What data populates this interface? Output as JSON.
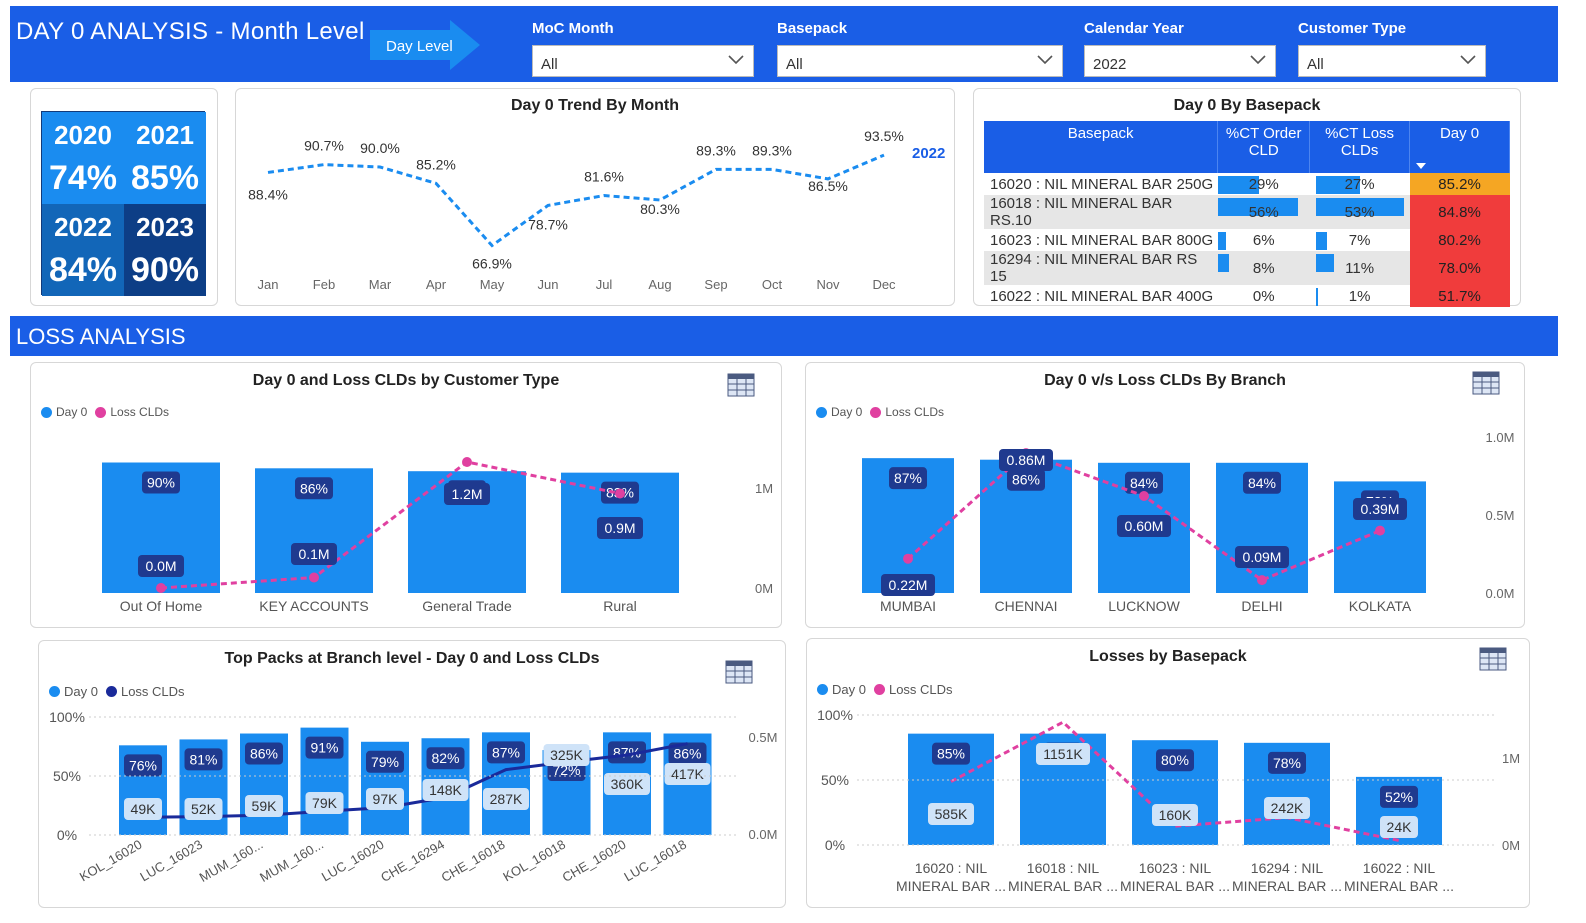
{
  "header": {
    "title": "DAY 0 ANALYSIS - Month Level",
    "day_level_button": "Day Level",
    "filters": [
      {
        "label": "MoC Month",
        "value": "All"
      },
      {
        "label": "Basepack",
        "value": "All"
      },
      {
        "label": "Calendar Year",
        "value": "2022"
      },
      {
        "label": "Customer Type",
        "value": "All"
      }
    ]
  },
  "year_cards": [
    {
      "year": "2020",
      "pct": "74%",
      "color": "#1a8cf0"
    },
    {
      "year": "2021",
      "pct": "85%",
      "color": "#1a8cf0"
    },
    {
      "year": "2022",
      "pct": "84%",
      "color": "#1266b8"
    },
    {
      "year": "2023",
      "pct": "90%",
      "color": "#0d3e86"
    }
  ],
  "trend": {
    "title": "Day 0 Trend By Month",
    "series_label": "2022",
    "chart_data": {
      "type": "line",
      "categories": [
        "Jan",
        "Feb",
        "Mar",
        "Apr",
        "May",
        "Jun",
        "Jul",
        "Aug",
        "Sep",
        "Oct",
        "Nov",
        "Dec"
      ],
      "values": [
        88.4,
        90.7,
        90.0,
        85.2,
        66.9,
        78.7,
        81.6,
        80.3,
        89.3,
        89.3,
        86.5,
        93.5
      ],
      "labels": [
        "88.4%",
        "90.7%",
        "90.0%",
        "85.2%",
        "66.9%",
        "78.7%",
        "81.6%",
        "80.3%",
        "89.3%",
        "89.3%",
        "86.5%",
        "93.5%"
      ],
      "color": "#1a8cf0"
    }
  },
  "basepack_table": {
    "title": "Day 0 By Basepack",
    "columns": [
      "Basepack",
      "%CT Order CLD",
      "%CT Loss CLDs",
      "Day 0"
    ],
    "rows": [
      {
        "name": "16020 : NIL MINERAL BAR 250G",
        "order": "29%",
        "order_v": 29,
        "loss": "27%",
        "loss_v": 27,
        "day0": "85.2%",
        "color": "#f5a623"
      },
      {
        "name": "16018 : NIL MINERAL BAR RS.10",
        "order": "56%",
        "order_v": 56,
        "loss": "53%",
        "loss_v": 53,
        "day0": "84.8%",
        "color": "#f03c3c"
      },
      {
        "name": "16023 : NIL MINERAL BAR 800G",
        "order": "6%",
        "order_v": 6,
        "loss": "7%",
        "loss_v": 7,
        "day0": "80.2%",
        "color": "#f03c3c"
      },
      {
        "name": "16294 : NIL MINERAL BAR RS 15",
        "order": "8%",
        "order_v": 8,
        "loss": "11%",
        "loss_v": 11,
        "day0": "78.0%",
        "color": "#f03c3c"
      },
      {
        "name": "16022 : NIL MINERAL BAR 400G",
        "order": "0%",
        "order_v": 0,
        "loss": "1%",
        "loss_v": 1,
        "day0": "51.7%",
        "color": "#f03c3c"
      }
    ]
  },
  "loss_section": {
    "title": "LOSS ANALYSIS"
  },
  "legend": {
    "day0": "Day 0",
    "loss": "Loss CLDs"
  },
  "colors": {
    "blue": "#1a8cf0",
    "pink": "#e040a0",
    "navy": "#1a2a9a",
    "label_bg": "#1f3a8f"
  },
  "customer_chart": {
    "title": "Day 0 and Loss CLDs by Customer Type",
    "chart_data": {
      "type": "bar",
      "categories": [
        "Out Of Home",
        "KEY ACCOUNTS",
        "General Trade",
        "Rural"
      ],
      "day0_pct": [
        90,
        86,
        84,
        83
      ],
      "day0_labels": [
        "90%",
        "86%",
        "84%",
        "83%"
      ],
      "loss_values": [
        0.0,
        0.1,
        1.2,
        0.9
      ],
      "loss_labels": [
        "0.0M",
        "0.1M",
        "1.2M",
        "0.9M"
      ],
      "right_axis_ticks": [
        "1M",
        "0M"
      ]
    }
  },
  "branch_chart": {
    "title": "Day 0 v/s Loss CLDs By Branch",
    "chart_data": {
      "type": "bar",
      "categories": [
        "MUMBAI",
        "CHENNAI",
        "LUCKNOW",
        "DELHI",
        "KOLKATA"
      ],
      "day0_pct": [
        87,
        86,
        84,
        84,
        72
      ],
      "day0_labels": [
        "87%",
        "86%",
        "84%",
        "84%",
        "72%"
      ],
      "loss_values": [
        0.22,
        0.86,
        0.6,
        0.09,
        0.39
      ],
      "loss_labels": [
        "0.22M",
        "0.86M",
        "0.60M",
        "0.09M",
        "0.39M"
      ],
      "right_axis_ticks": [
        "1.0M",
        "0.5M",
        "0.0M"
      ]
    }
  },
  "packs_chart": {
    "title": "Top Packs at Branch level - Day 0 and Loss CLDs",
    "chart_data": {
      "type": "bar",
      "categories": [
        "KOL_16020",
        "LUC_16023",
        "MUM_160...",
        "MUM_160...",
        "LUC_16020",
        "CHE_16294",
        "CHE_16018",
        "KOL_16018",
        "CHE_16020",
        "LUC_16018"
      ],
      "day0_pct": [
        76,
        81,
        86,
        91,
        79,
        82,
        87,
        72,
        87,
        86
      ],
      "day0_labels": [
        "76%",
        "81%",
        "86%",
        "91%",
        "79%",
        "82%",
        "87%",
        "72%",
        "87%",
        "86%"
      ],
      "loss_values": [
        49,
        52,
        59,
        79,
        97,
        148,
        287,
        325,
        360,
        417
      ],
      "loss_labels": [
        "49K",
        "52K",
        "59K",
        "79K",
        "97K",
        "148K",
        "287K",
        "325K",
        "360K",
        "417K"
      ],
      "left_axis_ticks": [
        "100%",
        "50%",
        "0%"
      ],
      "right_axis_ticks": [
        "0.5M",
        "0.0M"
      ]
    }
  },
  "losses_chart": {
    "title": "Losses by Basepack",
    "chart_data": {
      "type": "bar",
      "categories": [
        "16020 : NIL MINERAL BAR ...",
        "16018 : NIL MINERAL BAR ...",
        "16023 : NIL MINERAL BAR ...",
        "16294 : NIL MINERAL BAR ...",
        "16022 : NIL MINERAL BAR ..."
      ],
      "day0_pct": [
        85,
        85,
        80,
        78,
        52
      ],
      "day0_labels": [
        "85%",
        "85%",
        "80%",
        "78%",
        "52%"
      ],
      "loss_values": [
        585,
        1151,
        160,
        242,
        24
      ],
      "loss_labels": [
        "585K",
        "1151K",
        "160K",
        "242K",
        "24K"
      ],
      "left_axis_ticks": [
        "100%",
        "50%",
        "0%"
      ],
      "right_axis_ticks": [
        "1M",
        "0M"
      ]
    }
  }
}
